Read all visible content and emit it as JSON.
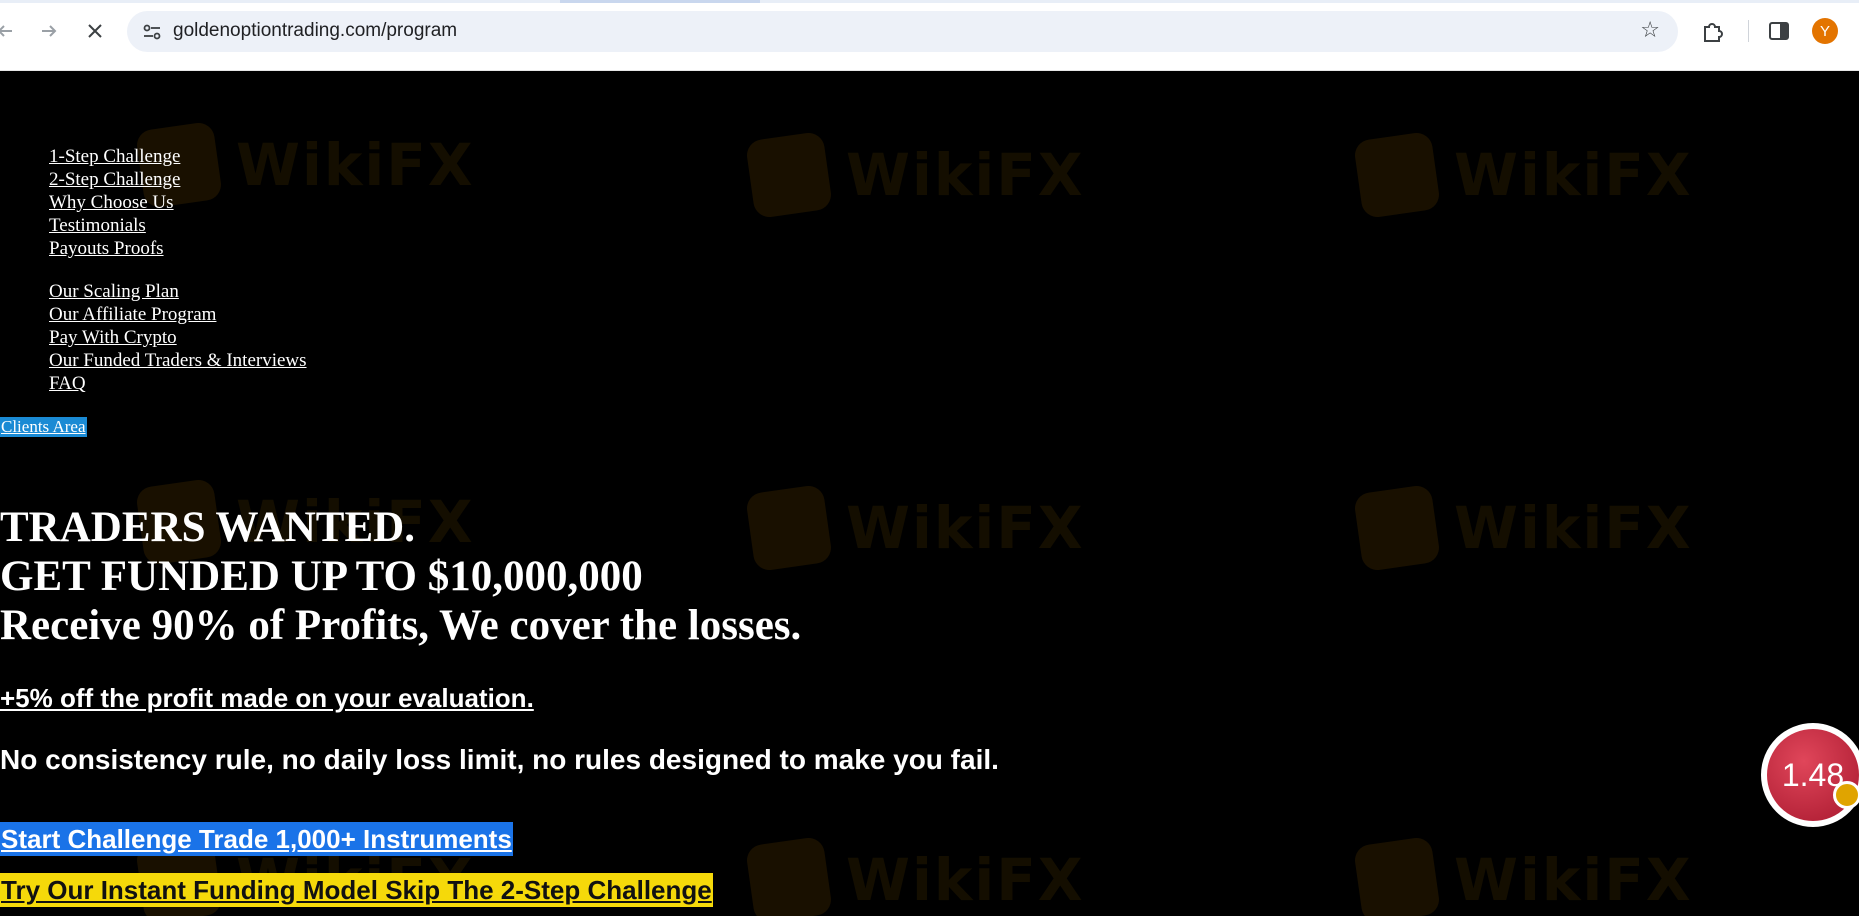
{
  "browser": {
    "url": "goldenoptiontrading.com/program",
    "profile_initial": "Y",
    "icons": {
      "back": "arrow-left-icon",
      "forward": "arrow-right-icon",
      "stop": "close-icon",
      "site_info": "tune-icon",
      "bookmark": "star-icon",
      "extensions": "puzzle-icon",
      "side_panel": "side-panel-icon"
    }
  },
  "nav": {
    "group1": [
      "1-Step Challenge",
      "2-Step Challenge",
      "Why Choose Us",
      "Testimonials",
      "Payouts Proofs"
    ],
    "group2": [
      "Our Scaling Plan",
      "Our Affiliate Program",
      "Pay With Crypto",
      "Our Funded Traders & Interviews",
      "FAQ"
    ]
  },
  "clients_area": "Clients Area",
  "hero": {
    "line1": "TRADERS WANTED.",
    "line2": "GET FUNDED UP TO $10,000,000",
    "line3": "Receive 90% of Profits, We cover the losses.",
    "offer": "+5% off the profit made on your evaluation.",
    "no_rules": "No consistency rule, no daily loss limit, no rules designed to make you fail.",
    "cta_primary": "Start Challenge Trade 1,000+ Instruments",
    "cta_secondary": "Try Our Instant Funding Model Skip The 2-Step Challenge"
  },
  "watermark_text": "WikiFX",
  "rating_badge": "1.48",
  "colors": {
    "page_bg": "#000000",
    "cta_primary_bg": "#1a73e8",
    "cta_secondary_bg": "#f5d90a",
    "clients_bg": "#1a8ad4",
    "badge": "#c8283e"
  }
}
